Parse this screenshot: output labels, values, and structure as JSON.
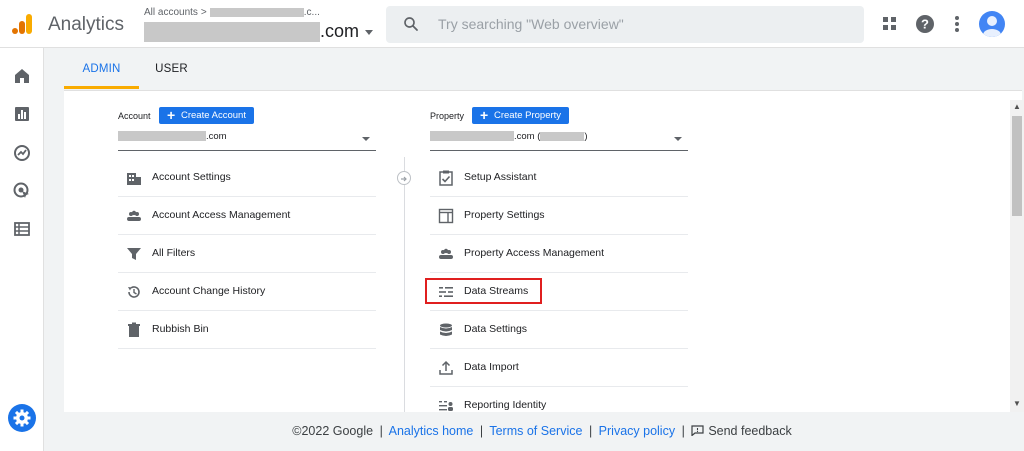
{
  "header": {
    "app_title": "Analytics",
    "breadcrumb": {
      "root": "All accounts",
      "separator": ">",
      "tail": ".c..."
    },
    "account_name_suffix": ".com",
    "search_placeholder": "Try searching \"Web overview\""
  },
  "tabs": [
    {
      "label": "ADMIN",
      "active": true
    },
    {
      "label": "USER",
      "active": false
    }
  ],
  "account": {
    "label": "Account",
    "create_label": "Create Account",
    "selector_suffix": ".com",
    "items": [
      {
        "label": "Account Settings",
        "icon": "building-icon"
      },
      {
        "label": "Account Access Management",
        "icon": "people-icon"
      },
      {
        "label": "All Filters",
        "icon": "filter-icon"
      },
      {
        "label": "Account Change History",
        "icon": "history-icon"
      },
      {
        "label": "Rubbish Bin",
        "icon": "trash-icon"
      }
    ]
  },
  "property": {
    "label": "Property",
    "create_label": "Create Property",
    "selector_suffix": ".com (",
    "selector_close": ")",
    "items": [
      {
        "label": "Setup Assistant",
        "icon": "checklist-icon"
      },
      {
        "label": "Property Settings",
        "icon": "property-icon"
      },
      {
        "label": "Property Access Management",
        "icon": "people-icon"
      },
      {
        "label": "Data Streams",
        "icon": "streams-icon",
        "highlighted": true
      },
      {
        "label": "Data Settings",
        "icon": "database-icon"
      },
      {
        "label": "Data Import",
        "icon": "upload-icon"
      },
      {
        "label": "Reporting Identity",
        "icon": "identity-icon"
      }
    ]
  },
  "footer": {
    "copyright": "©2022 Google",
    "links": [
      "Analytics home",
      "Terms of Service",
      "Privacy policy"
    ],
    "separator": "|",
    "feedback": "Send feedback"
  },
  "colors": {
    "accent": "#1a73e8",
    "tab_underline": "#f9ab00",
    "highlight": "#e01f1f"
  }
}
